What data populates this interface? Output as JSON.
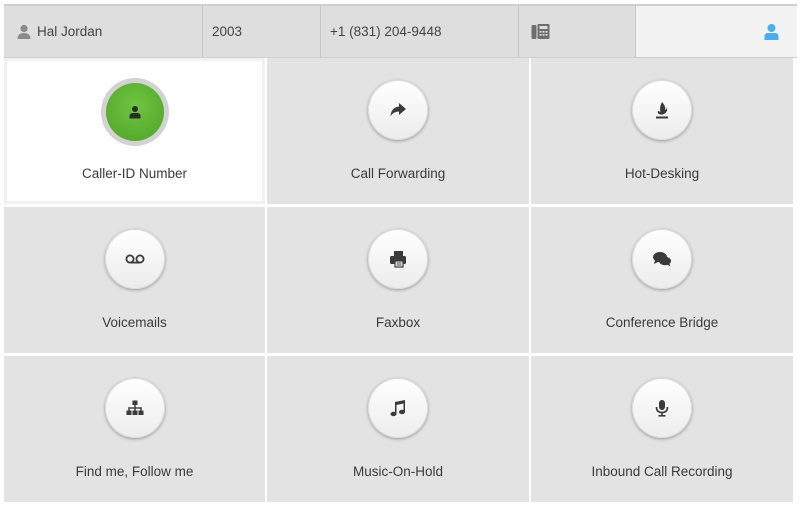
{
  "header": {
    "user_name": "Hal Jordan",
    "extension": "2003",
    "phone_number": "+1 (831) 204-9448",
    "device_icon": "desk-phone-icon",
    "account_icon": "user-icon",
    "account_icon_color": "#4aaee8"
  },
  "tiles": [
    {
      "label": "Caller-ID Number",
      "icon": "user-icon",
      "active": true,
      "accent": "#5cb82f"
    },
    {
      "label": "Call Forwarding",
      "icon": "share-arrow-icon"
    },
    {
      "label": "Hot-Desking",
      "icon": "fire-icon"
    },
    {
      "label": "Voicemails",
      "icon": "voicemail-icon"
    },
    {
      "label": "Faxbox",
      "icon": "fax-icon"
    },
    {
      "label": "Conference Bridge",
      "icon": "chat-bubbles-icon"
    },
    {
      "label": "Find me, Follow me",
      "icon": "sitemap-icon"
    },
    {
      "label": "Music-On-Hold",
      "icon": "music-note-icon"
    },
    {
      "label": "Inbound Call Recording",
      "icon": "microphone-icon"
    }
  ]
}
